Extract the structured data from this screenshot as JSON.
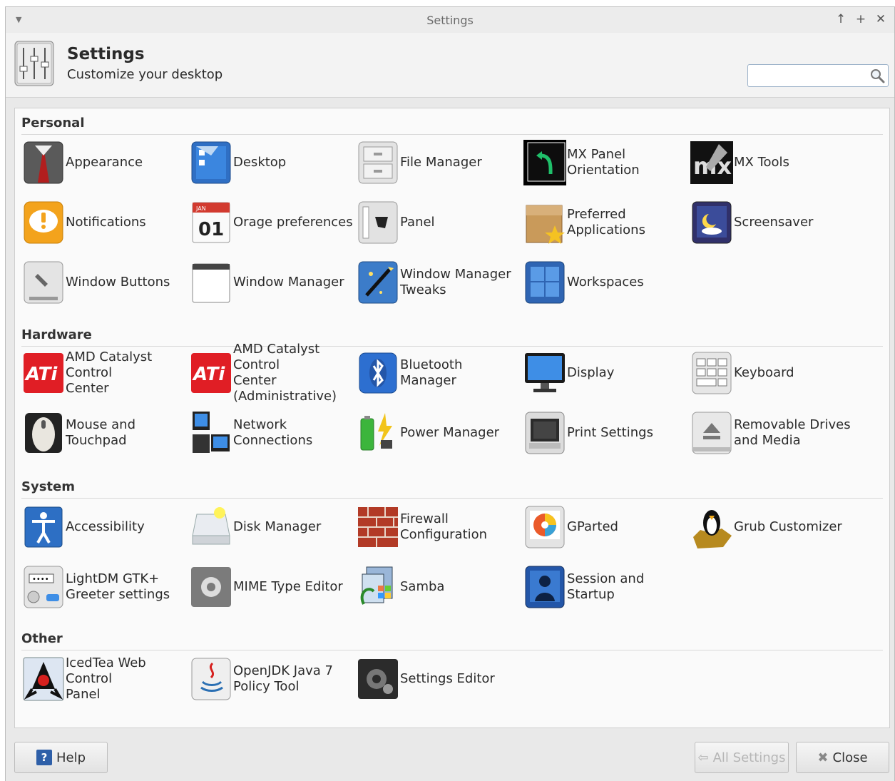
{
  "window": {
    "title": "Settings"
  },
  "header": {
    "title": "Settings",
    "subtitle": "Customize your desktop",
    "search_value": ""
  },
  "sections": [
    {
      "title": "Personal",
      "items": [
        {
          "label": "Appearance",
          "icon": "appearance-icon"
        },
        {
          "label": "Desktop",
          "icon": "desktop-icon"
        },
        {
          "label": "File Manager",
          "icon": "file-manager-icon"
        },
        {
          "label": "MX Panel Orientation",
          "icon": "mx-panel-orientation-icon"
        },
        {
          "label": "MX Tools",
          "icon": "mx-tools-icon"
        },
        {
          "label": "Notifications",
          "icon": "notifications-icon"
        },
        {
          "label": "Orage preferences",
          "icon": "calendar-icon"
        },
        {
          "label": "Panel",
          "icon": "panel-icon"
        },
        {
          "label": "Preferred\nApplications",
          "icon": "preferred-applications-icon"
        },
        {
          "label": "Screensaver",
          "icon": "screensaver-icon"
        },
        {
          "label": "Window Buttons",
          "icon": "window-buttons-icon"
        },
        {
          "label": "Window Manager",
          "icon": "window-manager-icon"
        },
        {
          "label": "Window Manager\nTweaks",
          "icon": "window-manager-tweaks-icon"
        },
        {
          "label": "Workspaces",
          "icon": "workspaces-icon"
        }
      ]
    },
    {
      "title": "Hardware",
      "items": [
        {
          "label": "AMD Catalyst Control\nCenter",
          "icon": "ati-icon"
        },
        {
          "label": "AMD Catalyst Control\nCenter\n(Administrative)",
          "icon": "ati-admin-icon"
        },
        {
          "label": "Bluetooth Manager",
          "icon": "bluetooth-icon"
        },
        {
          "label": "Display",
          "icon": "display-icon"
        },
        {
          "label": "Keyboard",
          "icon": "keyboard-icon"
        },
        {
          "label": "Mouse and Touchpad",
          "icon": "mouse-icon"
        },
        {
          "label": "Network Connections",
          "icon": "network-icon"
        },
        {
          "label": "Power Manager",
          "icon": "power-manager-icon"
        },
        {
          "label": "Print Settings",
          "icon": "printer-icon"
        },
        {
          "label": "Removable Drives\nand Media",
          "icon": "removable-drives-icon"
        }
      ]
    },
    {
      "title": "System",
      "items": [
        {
          "label": "Accessibility",
          "icon": "accessibility-icon"
        },
        {
          "label": "Disk Manager",
          "icon": "disk-manager-icon"
        },
        {
          "label": "Firewall Configuration",
          "icon": "firewall-icon"
        },
        {
          "label": "GParted",
          "icon": "gparted-icon"
        },
        {
          "label": "Grub Customizer",
          "icon": "grub-customizer-icon"
        },
        {
          "label": "LightDM GTK+\nGreeter settings",
          "icon": "lightdm-icon"
        },
        {
          "label": "MIME Type Editor",
          "icon": "mime-editor-icon"
        },
        {
          "label": "Samba",
          "icon": "samba-icon"
        },
        {
          "label": "Session and Startup",
          "icon": "session-startup-icon"
        }
      ]
    },
    {
      "title": "Other",
      "items": [
        {
          "label": "IcedTea Web Control\nPanel",
          "icon": "icedtea-icon"
        },
        {
          "label": "OpenJDK Java 7\nPolicy Tool",
          "icon": "java-icon"
        },
        {
          "label": "Settings Editor",
          "icon": "settings-editor-icon"
        }
      ]
    }
  ],
  "footer": {
    "help": "Help",
    "all_settings": "All Settings",
    "close": "Close"
  }
}
